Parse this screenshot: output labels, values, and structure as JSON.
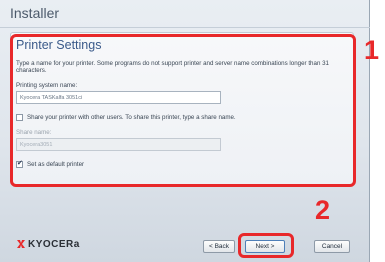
{
  "window": {
    "title": "Installer"
  },
  "settings": {
    "section_title": "Printer Settings",
    "description": "Type a name for your printer. Some programs do not support printer and server name combinations longer than 31 characters.",
    "printing_system_name_label": "Printing system name:",
    "printing_system_name_value": "Kyocera TASKalfa 3051ci",
    "share_checkbox_label": "Share your printer with other users. To share this printer, type a share name.",
    "share_checked": false,
    "share_name_label": "Share name:",
    "share_name_value": "Kyocera3051",
    "default_checkbox_label": "Set as default printer",
    "default_checked": true
  },
  "callouts": {
    "one": "1",
    "two": "2"
  },
  "branding": {
    "logo_text": "KYOCERa",
    "logo_color": "#e8282a"
  },
  "buttons": {
    "back": "< Back",
    "next": "Next >",
    "cancel": "Cancel"
  },
  "colors": {
    "highlight": "#e8282a",
    "title": "#3a5a8a"
  }
}
